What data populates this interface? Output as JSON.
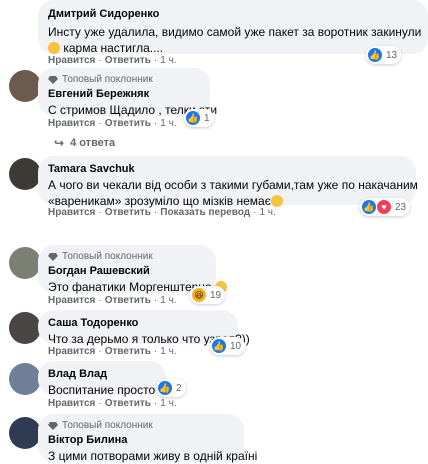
{
  "comments": [
    {
      "name": "Дмитрий Сидоренко",
      "text1": "Инсту уже удалила, видимо самой уже пакет за воротник закинули",
      "text2": " карма настигла....",
      "like": "Нравится",
      "reply": "Ответить",
      "time": "1 ч.",
      "reactions": "13"
    },
    {
      "badge": "Топовый поклонник",
      "name": "Евгений Бережняк",
      "text": "С стримов Щадило , телки эти",
      "like": "Нравится",
      "reply": "Ответить",
      "time": "1 ч.",
      "reactions": "1"
    },
    {
      "name": "Tamara Savchuk",
      "text1": "А чого ви чекали від особи з такими губами,там уже по накачаним",
      "text2": "«вареникам» зрозуміло що мізків немає",
      "like": "Нравится",
      "reply": "Ответить",
      "translate": "Показать перевод",
      "time": "1 ч.",
      "reactions": "23"
    },
    {
      "badge": "Топовый поклонник",
      "name": "Богдан Рашевский",
      "text": "Это фанатики Моргенштерна",
      "like": "Нравится",
      "reply": "Ответить",
      "time": "1 ч.",
      "reactions": "19"
    },
    {
      "name": "Саша Тодоренко",
      "text": "Что за дерьмо я только что узрел?))",
      "like": "Нравится",
      "reply": "Ответить",
      "time": "1 ч.",
      "reactions": "10"
    },
    {
      "name": "Влад Влад",
      "text": "Воспитание просто 0",
      "like": "Нравится",
      "reply": "Ответить",
      "time": "1 ч.",
      "reactions": "2"
    },
    {
      "badge": "Топовый поклонник",
      "name": "Віктор Билина",
      "text": "З цими потворами живу в одній країні"
    }
  ],
  "replies_link": "4 ответа",
  "separator": "·",
  "colors": {
    "bubble": "#f0f2f5",
    "like_blue": "#1877f2",
    "meta": "#65676b"
  },
  "icons": [
    "gem-icon",
    "like-icon",
    "haha-icon",
    "heart-icon",
    "reply-arrow-icon",
    "wink-emoji",
    "laugh-emoji"
  ]
}
